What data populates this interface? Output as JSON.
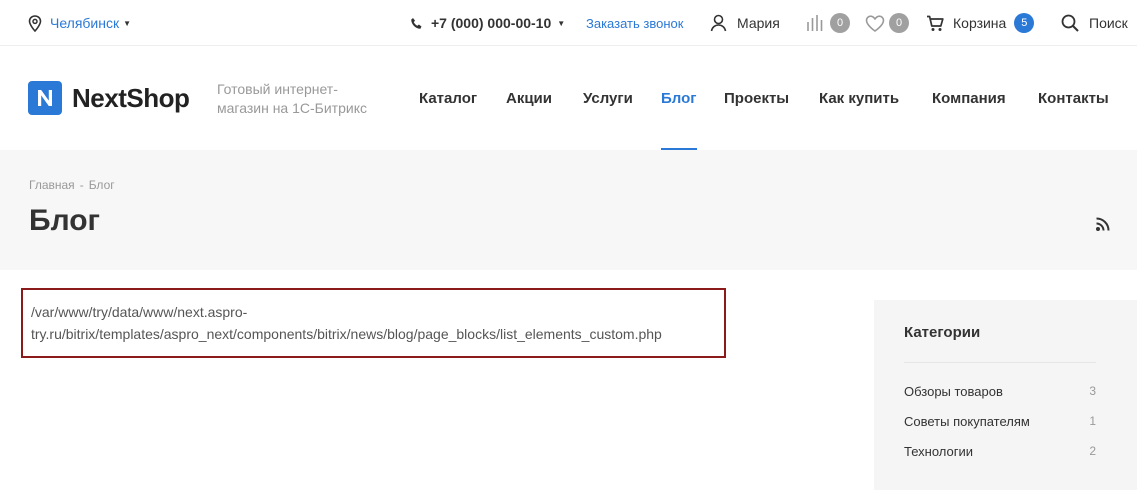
{
  "topbar": {
    "city": "Челябинск",
    "phone": "+7 (000) 000-00-10",
    "callback": "Заказать звонок",
    "user": "Мария",
    "compare_count": "0",
    "favorites_count": "0",
    "cart_label": "Корзина",
    "cart_count": "5",
    "search_label": "Поиск",
    "icons": [
      "location-pin-icon",
      "phone-icon",
      "user-icon",
      "compare-icon",
      "heart-icon",
      "cart-icon",
      "search-icon"
    ]
  },
  "header": {
    "logo_text": "NextShop",
    "slogan": "Готовый интернет-магазин на 1С-Битрикс",
    "nav": [
      {
        "label": "Каталог",
        "active": false
      },
      {
        "label": "Акции",
        "active": false
      },
      {
        "label": "Услуги",
        "active": false
      },
      {
        "label": "Блог",
        "active": true
      },
      {
        "label": "Проекты",
        "active": false
      },
      {
        "label": "Как купить",
        "active": false
      },
      {
        "label": "Компания",
        "active": false
      },
      {
        "label": "Контакты",
        "active": false
      }
    ]
  },
  "breadcrumb": {
    "home": "Главная",
    "separator": "-",
    "current": "Блог"
  },
  "page_title": "Блог",
  "error_message": "/var/www/try/data/www/next.aspro-try.ru/bitrix/templates/aspro_next/components/bitrix/news/blog/page_blocks/list_elements_custom.php",
  "sidebar": {
    "title": "Категории",
    "categories": [
      {
        "name": "Обзоры товаров",
        "count": "3"
      },
      {
        "name": "Советы покупателям",
        "count": "1"
      },
      {
        "name": "Технологии",
        "count": "2"
      }
    ]
  },
  "colors": {
    "accent": "#2b79d6",
    "error_border": "#8b1a1a",
    "muted": "#999999",
    "panel": "#f7f7f7"
  }
}
